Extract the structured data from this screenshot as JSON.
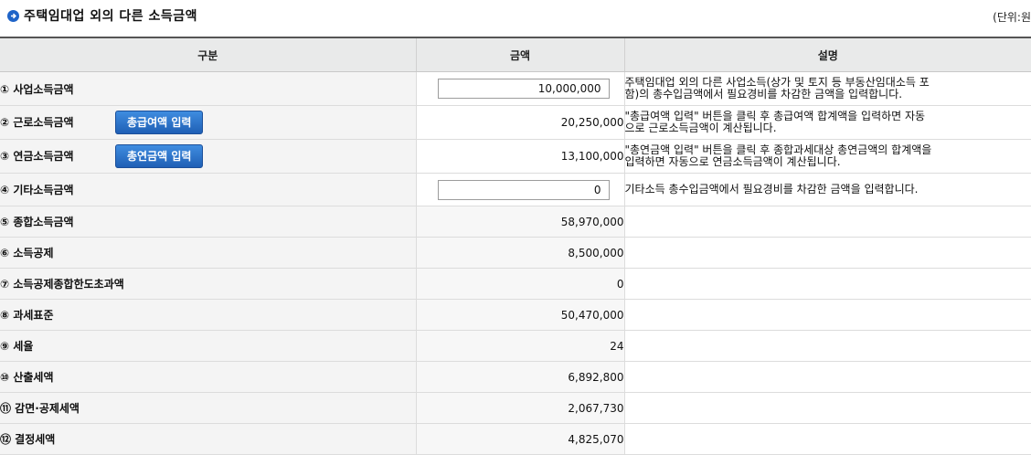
{
  "header": {
    "title": "주택임대업 외의 다른 소득금액",
    "unit": "(단위:원"
  },
  "table": {
    "columns": [
      "구분",
      "금액",
      "설명"
    ],
    "rows": [
      {
        "label": "① 사업소득금액",
        "value": "10,000,000",
        "input": true,
        "desc_1": "주택임대업 외의 다른 사업소득(상가 및 토지 등 부동산임대소득 포",
        "desc_2": "함)의 총수입금액에서 필요경비를 차감한 금액을 입력합니다."
      },
      {
        "label": "② 근로소득금액",
        "value": "20,250,000",
        "button": "총급여액 입력",
        "desc_1": "\"총급여액 입력\" 버튼을 클릭 후 총급여액 합계액을 입력하면 자동",
        "desc_2": "으로 근로소득금액이 계산됩니다."
      },
      {
        "label": "③ 연금소득금액",
        "value": "13,100,000",
        "button": "총연금액 입력",
        "desc_1": "\"총연금액 입력\" 버튼을 클릭 후 종합과세대상 총연금액의 합계액을",
        "desc_2": "입력하면 자동으로 연금소득금액이 계산됩니다."
      },
      {
        "label": "④ 기타소득금액",
        "value": "0",
        "input": true,
        "desc_1": "기타소득 총수입금액에서 필요경비를 차감한 금액을 입력합니다.",
        "desc_2": ""
      },
      {
        "label": "⑤ 종합소득금액",
        "value": "58,970,000"
      },
      {
        "label": "⑥ 소득공제",
        "value": "8,500,000"
      },
      {
        "label": "⑦ 소득공제종합한도초과액",
        "value": "0"
      },
      {
        "label": "⑧ 과세표준",
        "value": "50,470,000"
      },
      {
        "label": "⑨ 세율",
        "value": "24"
      },
      {
        "label": "⑩ 산출세액",
        "value": "6,892,800"
      },
      {
        "label": "⑪ 감면·공제세액",
        "value": "2,067,730"
      },
      {
        "label": "⑫ 결정세액",
        "value": "4,825,070"
      }
    ]
  }
}
